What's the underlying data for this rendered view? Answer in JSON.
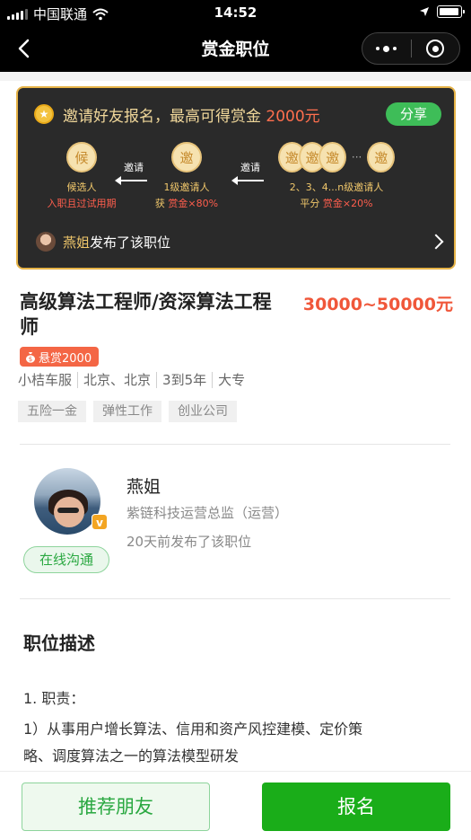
{
  "status_bar": {
    "carrier": "中国联通",
    "time": "14:52",
    "battery_level": 0.82
  },
  "nav": {
    "title": "赏金职位",
    "icons": [
      "back-arrow-icon",
      "more-dots-icon",
      "close-target-icon"
    ]
  },
  "invite": {
    "title_prefix": "邀请好友报名，最高可得赏金",
    "title_amount": "2000元",
    "share_label": "分享",
    "nodes": [
      {
        "circle": "候",
        "line1": "候选人",
        "line2": "入职且过试用期"
      },
      {
        "circle": "邀",
        "line1": "1级邀请人",
        "line2_prefix": "获",
        "line2_value": "赏金×80%"
      },
      {
        "circles": [
          "邀",
          "邀",
          "邀",
          "···",
          "邀"
        ],
        "line1": "2、3、4...n级邀请人",
        "line2_prefix": "平分",
        "line2_value": "赏金×20%"
      }
    ],
    "arrow_label": "邀请",
    "publisher_name": "燕姐",
    "publisher_suffix": "发布了该职位"
  },
  "job": {
    "title": "高级算法工程师/资深算法工程师",
    "salary": "30000~50000元",
    "bounty": "悬赏2000",
    "meta": [
      "小桔车服",
      "北京、北京",
      "3到5年",
      "大专"
    ],
    "tags": [
      "五险一金",
      "弹性工作",
      "创业公司"
    ]
  },
  "poster": {
    "name": "燕姐",
    "title": "紫链科技运营总监（运营）",
    "time": "20天前发布了该职位",
    "verified_badge": "v",
    "online_label": "在线沟通"
  },
  "description": {
    "section_title": "职位描述",
    "line1": "1. 职责：",
    "line2": "1）从事用户增长算法、信用和资产风控建模、定价策",
    "line3": "略、调度算法之一的算法模型研发"
  },
  "actions": {
    "recommend_label": "推荐朋友",
    "apply_label": "报名"
  },
  "colors": {
    "accent_green": "#1aad19",
    "gold": "#e6b347",
    "salary_red": "#f0573a"
  }
}
